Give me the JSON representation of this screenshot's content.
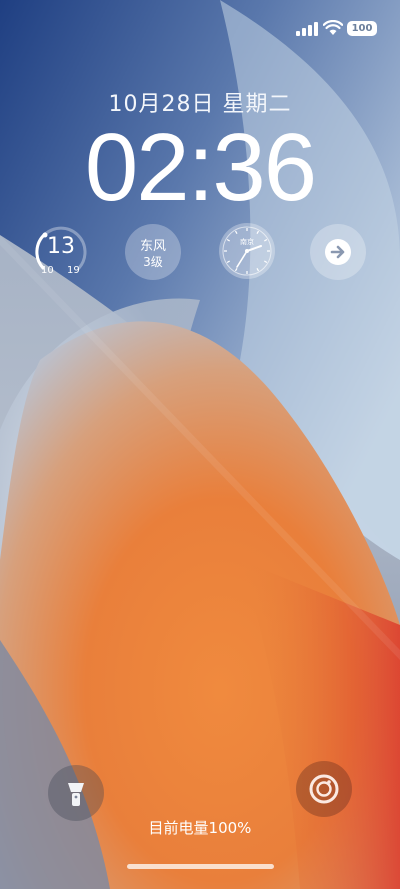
{
  "status_bar": {
    "battery_level": "100",
    "icons": [
      "signal-icon",
      "wifi-icon",
      "battery-icon"
    ]
  },
  "lockscreen": {
    "date": "10月28日  星期二",
    "time": "02:36"
  },
  "widgets": {
    "weather": {
      "current_temp": "13",
      "low": "10",
      "high": "19"
    },
    "wind": {
      "direction": "东风",
      "level": "3级"
    },
    "world_clock": {
      "city": "南京"
    },
    "more": {
      "icon": "arrow-right-icon"
    }
  },
  "quick_actions": {
    "flashlight": {
      "icon": "flashlight-icon"
    },
    "camera": {
      "icon": "camera-icon"
    }
  },
  "battery_status": "目前电量100%",
  "colors": {
    "wallpaper_blue": "#25498f",
    "wallpaper_light": "#c9d8e8",
    "wallpaper_orange": "#e8863a",
    "wallpaper_red": "#dd3b2c"
  }
}
